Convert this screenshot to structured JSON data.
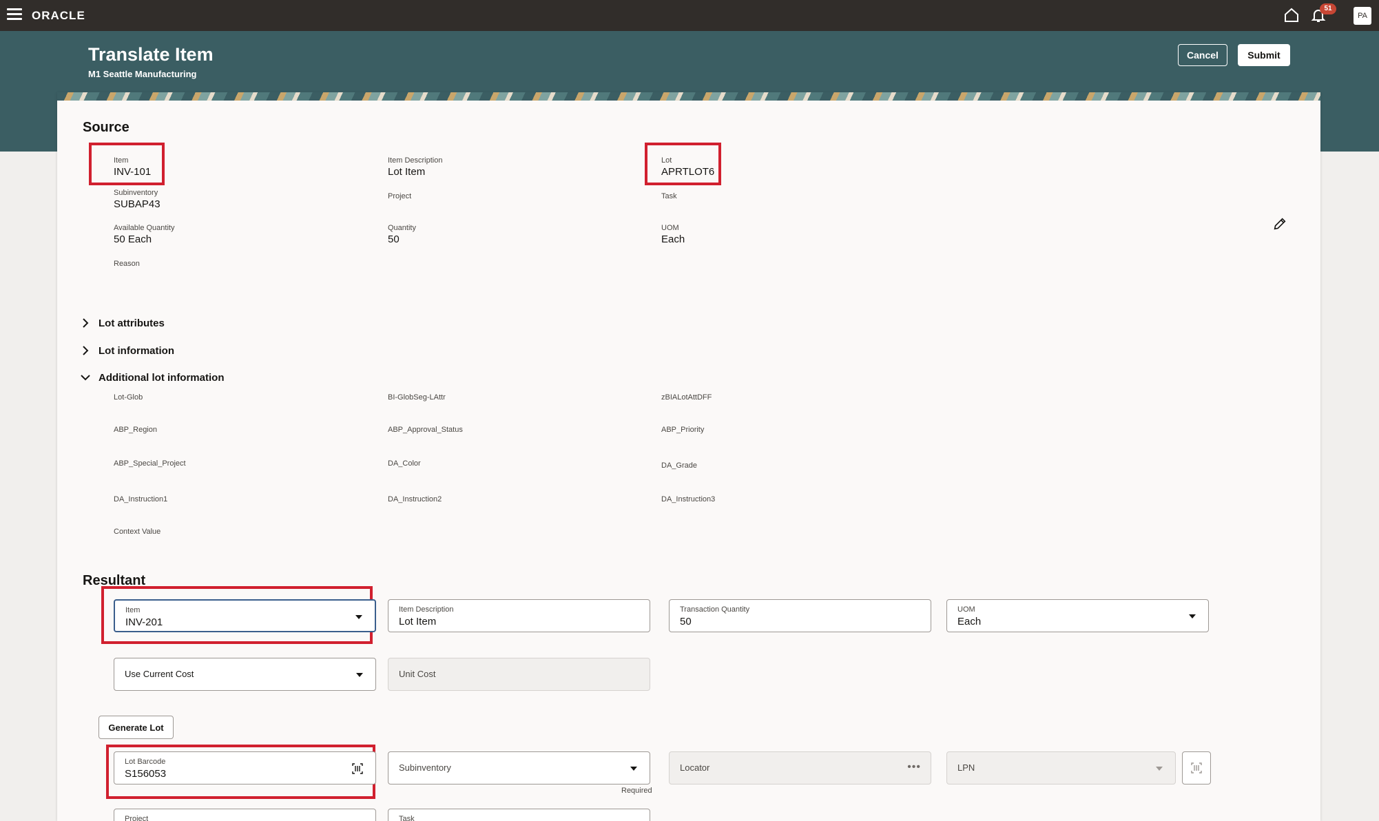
{
  "topbar": {
    "brand": "ORACLE",
    "notification_count": "51",
    "avatar_initials": "PA"
  },
  "header": {
    "title": "Translate Item",
    "subtitle": "M1 Seattle Manufacturing",
    "cancel_label": "Cancel",
    "submit_label": "Submit"
  },
  "source": {
    "title": "Source",
    "item_label": "Item",
    "item_value": "INV-101",
    "item_description_label": "Item Description",
    "item_description_value": "Lot Item",
    "lot_label": "Lot",
    "lot_value": "APRTLOT6",
    "subinventory_label": "Subinventory",
    "subinventory_value": "SUBAP43",
    "project_label": "Project",
    "task_label": "Task",
    "available_quantity_label": "Available Quantity",
    "available_quantity_value": "50 Each",
    "quantity_label": "Quantity",
    "quantity_value": "50",
    "uom_label": "UOM",
    "uom_value": "Each",
    "reason_label": "Reason"
  },
  "sections": {
    "lot_attributes": "Lot attributes",
    "lot_information": "Lot information",
    "additional_lot_information": "Additional lot information"
  },
  "additional_lot": {
    "lot_glob": "Lot-Glob",
    "bi_globseg": "BI-GlobSeg-LAttr",
    "zbia": "zBIALotAttDFF",
    "abp_region": "ABP_Region",
    "abp_approval_status": "ABP_Approval_Status",
    "abp_priority": "ABP_Priority",
    "abp_special_project": "ABP_Special_Project",
    "da_color": "DA_Color",
    "da_grade": "DA_Grade",
    "da_instruction1": "DA_Instruction1",
    "da_instruction2": "DA_Instruction2",
    "da_instruction3": "DA_Instruction3",
    "context_value": "Context Value"
  },
  "resultant": {
    "title": "Resultant",
    "item_label": "Item",
    "item_value": "INV-201",
    "item_description_label": "Item Description",
    "item_description_value": "Lot Item",
    "transaction_quantity_label": "Transaction Quantity",
    "transaction_quantity_value": "50",
    "uom_label": "UOM",
    "uom_value": "Each",
    "cost_option_value": "Use Current Cost",
    "unit_cost_placeholder": "Unit Cost",
    "generate_lot_label": "Generate Lot",
    "lot_barcode_label": "Lot Barcode",
    "lot_barcode_value": "S156053",
    "subinventory_placeholder": "Subinventory",
    "required_note": "Required",
    "locator_placeholder": "Locator",
    "lpn_placeholder": "LPN",
    "project_label": "Project",
    "task_label": "Task"
  },
  "colors": {
    "topbar": "#312d2a",
    "header_band": "#3b5e63",
    "highlight": "#d1202f",
    "badge": "#c74634"
  }
}
